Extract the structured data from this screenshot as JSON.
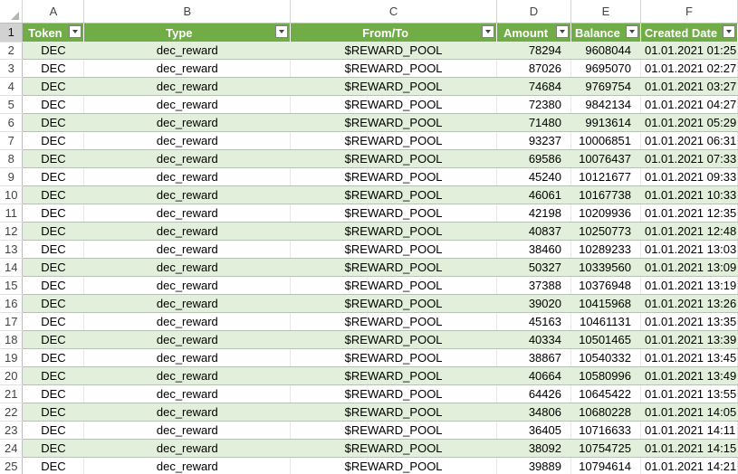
{
  "columns": [
    "A",
    "B",
    "C",
    "D",
    "E",
    "F"
  ],
  "headers": [
    "Token",
    "Type",
    "From/To",
    "Amount",
    "Balance",
    "Created Date"
  ],
  "rows": [
    {
      "num": "2",
      "token": "DEC",
      "type": "dec_reward",
      "from_to": "$REWARD_POOL",
      "amount": "78294",
      "balance": "9608044",
      "created": "01.01.2021 01:25"
    },
    {
      "num": "3",
      "token": "DEC",
      "type": "dec_reward",
      "from_to": "$REWARD_POOL",
      "amount": "87026",
      "balance": "9695070",
      "created": "01.01.2021 02:27"
    },
    {
      "num": "4",
      "token": "DEC",
      "type": "dec_reward",
      "from_to": "$REWARD_POOL",
      "amount": "74684",
      "balance": "9769754",
      "created": "01.01.2021 03:27"
    },
    {
      "num": "5",
      "token": "DEC",
      "type": "dec_reward",
      "from_to": "$REWARD_POOL",
      "amount": "72380",
      "balance": "9842134",
      "created": "01.01.2021 04:27"
    },
    {
      "num": "6",
      "token": "DEC",
      "type": "dec_reward",
      "from_to": "$REWARD_POOL",
      "amount": "71480",
      "balance": "9913614",
      "created": "01.01.2021 05:29"
    },
    {
      "num": "7",
      "token": "DEC",
      "type": "dec_reward",
      "from_to": "$REWARD_POOL",
      "amount": "93237",
      "balance": "10006851",
      "created": "01.01.2021 06:31"
    },
    {
      "num": "8",
      "token": "DEC",
      "type": "dec_reward",
      "from_to": "$REWARD_POOL",
      "amount": "69586",
      "balance": "10076437",
      "created": "01.01.2021 07:33"
    },
    {
      "num": "9",
      "token": "DEC",
      "type": "dec_reward",
      "from_to": "$REWARD_POOL",
      "amount": "45240",
      "balance": "10121677",
      "created": "01.01.2021 09:33"
    },
    {
      "num": "10",
      "token": "DEC",
      "type": "dec_reward",
      "from_to": "$REWARD_POOL",
      "amount": "46061",
      "balance": "10167738",
      "created": "01.01.2021 10:33"
    },
    {
      "num": "11",
      "token": "DEC",
      "type": "dec_reward",
      "from_to": "$REWARD_POOL",
      "amount": "42198",
      "balance": "10209936",
      "created": "01.01.2021 12:35"
    },
    {
      "num": "12",
      "token": "DEC",
      "type": "dec_reward",
      "from_to": "$REWARD_POOL",
      "amount": "40837",
      "balance": "10250773",
      "created": "01.01.2021 12:48"
    },
    {
      "num": "13",
      "token": "DEC",
      "type": "dec_reward",
      "from_to": "$REWARD_POOL",
      "amount": "38460",
      "balance": "10289233",
      "created": "01.01.2021 13:03"
    },
    {
      "num": "14",
      "token": "DEC",
      "type": "dec_reward",
      "from_to": "$REWARD_POOL",
      "amount": "50327",
      "balance": "10339560",
      "created": "01.01.2021 13:09"
    },
    {
      "num": "15",
      "token": "DEC",
      "type": "dec_reward",
      "from_to": "$REWARD_POOL",
      "amount": "37388",
      "balance": "10376948",
      "created": "01.01.2021 13:19"
    },
    {
      "num": "16",
      "token": "DEC",
      "type": "dec_reward",
      "from_to": "$REWARD_POOL",
      "amount": "39020",
      "balance": "10415968",
      "created": "01.01.2021 13:26"
    },
    {
      "num": "17",
      "token": "DEC",
      "type": "dec_reward",
      "from_to": "$REWARD_POOL",
      "amount": "45163",
      "balance": "10461131",
      "created": "01.01.2021 13:35"
    },
    {
      "num": "18",
      "token": "DEC",
      "type": "dec_reward",
      "from_to": "$REWARD_POOL",
      "amount": "40334",
      "balance": "10501465",
      "created": "01.01.2021 13:39"
    },
    {
      "num": "19",
      "token": "DEC",
      "type": "dec_reward",
      "from_to": "$REWARD_POOL",
      "amount": "38867",
      "balance": "10540332",
      "created": "01.01.2021 13:45"
    },
    {
      "num": "20",
      "token": "DEC",
      "type": "dec_reward",
      "from_to": "$REWARD_POOL",
      "amount": "40664",
      "balance": "10580996",
      "created": "01.01.2021 13:49"
    },
    {
      "num": "21",
      "token": "DEC",
      "type": "dec_reward",
      "from_to": "$REWARD_POOL",
      "amount": "64426",
      "balance": "10645422",
      "created": "01.01.2021 13:55"
    },
    {
      "num": "22",
      "token": "DEC",
      "type": "dec_reward",
      "from_to": "$REWARD_POOL",
      "amount": "34806",
      "balance": "10680228",
      "created": "01.01.2021 14:05"
    },
    {
      "num": "23",
      "token": "DEC",
      "type": "dec_reward",
      "from_to": "$REWARD_POOL",
      "amount": "36405",
      "balance": "10716633",
      "created": "01.01.2021 14:11"
    },
    {
      "num": "24",
      "token": "DEC",
      "type": "dec_reward",
      "from_to": "$REWARD_POOL",
      "amount": "38092",
      "balance": "10754725",
      "created": "01.01.2021 14:15"
    },
    {
      "num": "25",
      "token": "DEC",
      "type": "dec_reward",
      "from_to": "$REWARD_POOL",
      "amount": "39889",
      "balance": "10794614",
      "created": "01.01.2021 14:21"
    }
  ],
  "colors": {
    "header_bg": "#70ad47",
    "band_bg": "#e2efda",
    "row_border": "#a9d08e"
  }
}
